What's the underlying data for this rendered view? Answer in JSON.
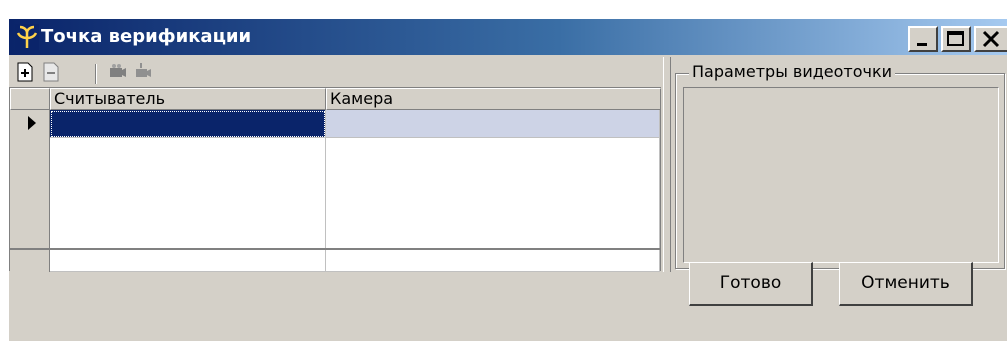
{
  "window": {
    "title": "Точка верификации",
    "title_bar_gradient": [
      "#0a246a",
      "#a6caf0"
    ],
    "controls": {
      "minimize_icon": "minimize-icon",
      "maximize_icon": "maximize-icon",
      "close_icon": "close-icon"
    }
  },
  "toolbar": {
    "icons": [
      "add-row-icon",
      "delete-row-icon",
      "camera-icon",
      "camera-disabled-icon"
    ]
  },
  "grid": {
    "columns": [
      "Считыватель",
      "Камера"
    ],
    "rows": [
      {
        "reader": "",
        "camera": "",
        "selected": true
      }
    ],
    "selection_color": "#0a246a"
  },
  "video_params": {
    "group_label": "Параметры видеоточки"
  },
  "buttons": {
    "ok_label": "Готово",
    "cancel_label": "Отменить"
  }
}
